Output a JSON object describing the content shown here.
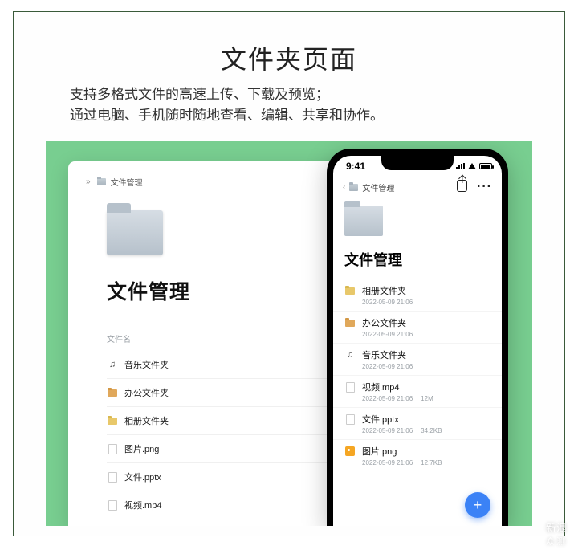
{
  "page": {
    "title": "文件夹页面",
    "subtitle_line1": "支持多格式文件的高速上传、下载及预览；",
    "subtitle_line2": "通过电脑、手机随时随地查看、编辑、共享和协作。"
  },
  "desktop": {
    "crumb_label": "文件管理",
    "heading": "文件管理",
    "column_name": "文件名",
    "files": [
      {
        "icon": "music-icon",
        "name": "音乐文件夹"
      },
      {
        "icon": "gold-folder-icon",
        "name": "办公文件夹"
      },
      {
        "icon": "photo-folder-icon",
        "name": "相册文件夹"
      },
      {
        "icon": "doc-icon",
        "name": "图片.png"
      },
      {
        "icon": "doc-icon",
        "name": "文件.pptx"
      },
      {
        "icon": "doc-icon",
        "name": "视频.mp4"
      }
    ]
  },
  "phone": {
    "status_time": "9:41",
    "crumb_label": "文件管理",
    "heading": "文件管理",
    "rows": [
      {
        "icon": "photo-folder-icon",
        "name": "相册文件夹",
        "time": "2022-05-09 21:06",
        "size": ""
      },
      {
        "icon": "gold-folder-icon",
        "name": "办公文件夹",
        "time": "2022-05-09 21:06",
        "size": ""
      },
      {
        "icon": "music-icon",
        "name": "音乐文件夹",
        "time": "2022-05-09 21:06",
        "size": ""
      },
      {
        "icon": "doc-icon",
        "name": "视频.mp4",
        "time": "2022-05-09 21:06",
        "size": "12M"
      },
      {
        "icon": "doc-icon",
        "name": "文件.pptx",
        "time": "2022-05-09 21:06",
        "size": "34.2KB"
      },
      {
        "icon": "image-orange-icon",
        "name": "图片.png",
        "time": "2022-05-09 21:06",
        "size": "12.7KB"
      }
    ]
  },
  "watermark": {
    "line1": "新浪",
    "line2": "众测"
  }
}
